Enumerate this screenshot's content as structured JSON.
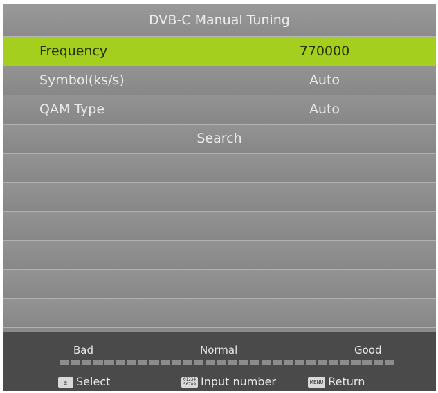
{
  "title": "DVB-C Manual Tuning",
  "rows": [
    {
      "label": "Frequency",
      "value": "770000",
      "selected": true
    },
    {
      "label": "Symbol(ks/s)",
      "value": "Auto"
    },
    {
      "label": "QAM Type",
      "value": "Auto"
    }
  ],
  "search_label": "Search",
  "signal": {
    "bad_label": "Bad",
    "normal_label": "Normal",
    "good_label": "Good",
    "segments": 30,
    "level": 0
  },
  "hints": {
    "select": "Select",
    "input_number_key": "01234 56789",
    "input_number": "Input number",
    "menu_key": "MENU",
    "return": "Return"
  },
  "colors": {
    "highlight": "#a4cf1f",
    "panel": "#8a8a8a",
    "footer": "#4a4a4a"
  }
}
